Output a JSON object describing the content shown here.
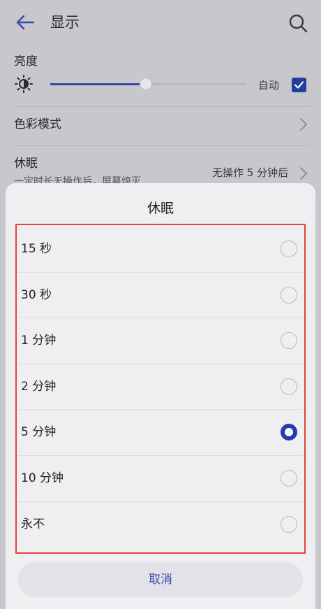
{
  "header": {
    "title": "显示",
    "back_icon": "arrow-left-icon",
    "search_icon": "search-icon"
  },
  "settings": {
    "brightness_label": "亮度",
    "brightness_level": 0.49,
    "auto_label": "自动",
    "auto_checked": true,
    "color_mode_label": "色彩模式",
    "sleep_label": "休眠",
    "sleep_value": "无操作 5 分钟后",
    "sleep_desc": "一定时长无操作后，屏幕熄灭"
  },
  "dialog": {
    "title": "休眠",
    "options": [
      {
        "label": "15 秒",
        "selected": false
      },
      {
        "label": "30 秒",
        "selected": false
      },
      {
        "label": "1 分钟",
        "selected": false
      },
      {
        "label": "2 分钟",
        "selected": false
      },
      {
        "label": "5 分钟",
        "selected": true
      },
      {
        "label": "10 分钟",
        "selected": false
      },
      {
        "label": "永不",
        "selected": false
      }
    ],
    "cancel_label": "取消"
  },
  "colors": {
    "accent": "#1f3fb0",
    "highlight": "#e8403f",
    "cancel_text": "#3a4fb5"
  }
}
